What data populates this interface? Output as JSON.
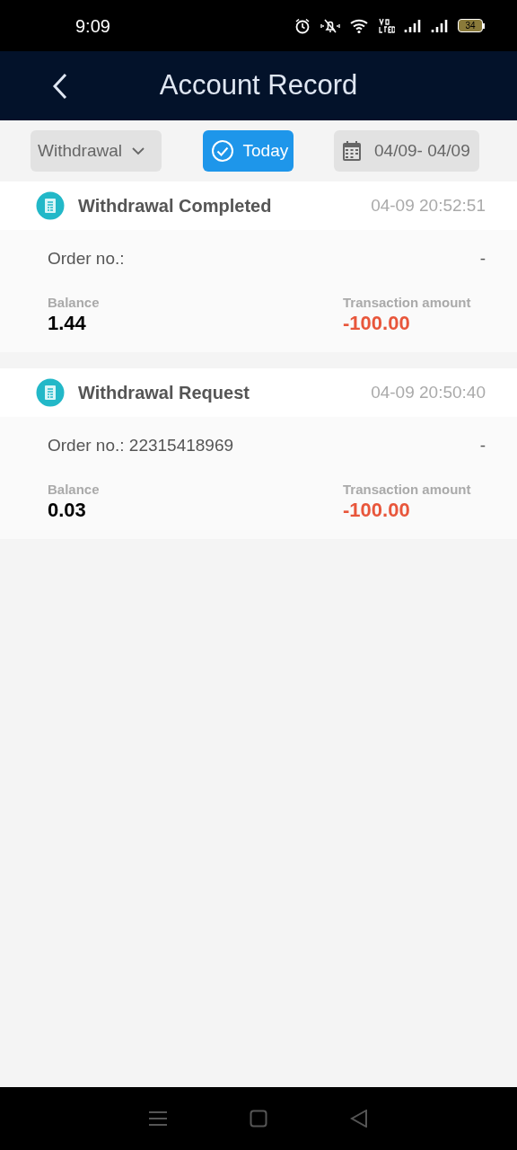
{
  "status_bar": {
    "time": "9:09",
    "battery": "34"
  },
  "header": {
    "title": "Account Record"
  },
  "filters": [
    {
      "kind": "dropdown",
      "label": "Withdrawal",
      "selected": false
    },
    {
      "kind": "toggle",
      "label": "Today",
      "selected": true
    },
    {
      "kind": "date",
      "label": "04/09- 04/09",
      "selected": false
    }
  ],
  "records": [
    {
      "title": "Withdrawal Completed",
      "time": "04-09 20:52:51",
      "order": "Order no.:",
      "order_status": "-",
      "balance_label": "Balance",
      "balance": "1.44",
      "amount_label": "Transaction amount",
      "amount": "-100.00"
    },
    {
      "title": "Withdrawal Request",
      "time": "04-09 20:50:40",
      "order": "Order no.: 22315418969",
      "order_status": "-",
      "balance_label": "Balance",
      "balance": "0.03",
      "amount_label": "Transaction amount",
      "amount": "-100.00"
    }
  ]
}
